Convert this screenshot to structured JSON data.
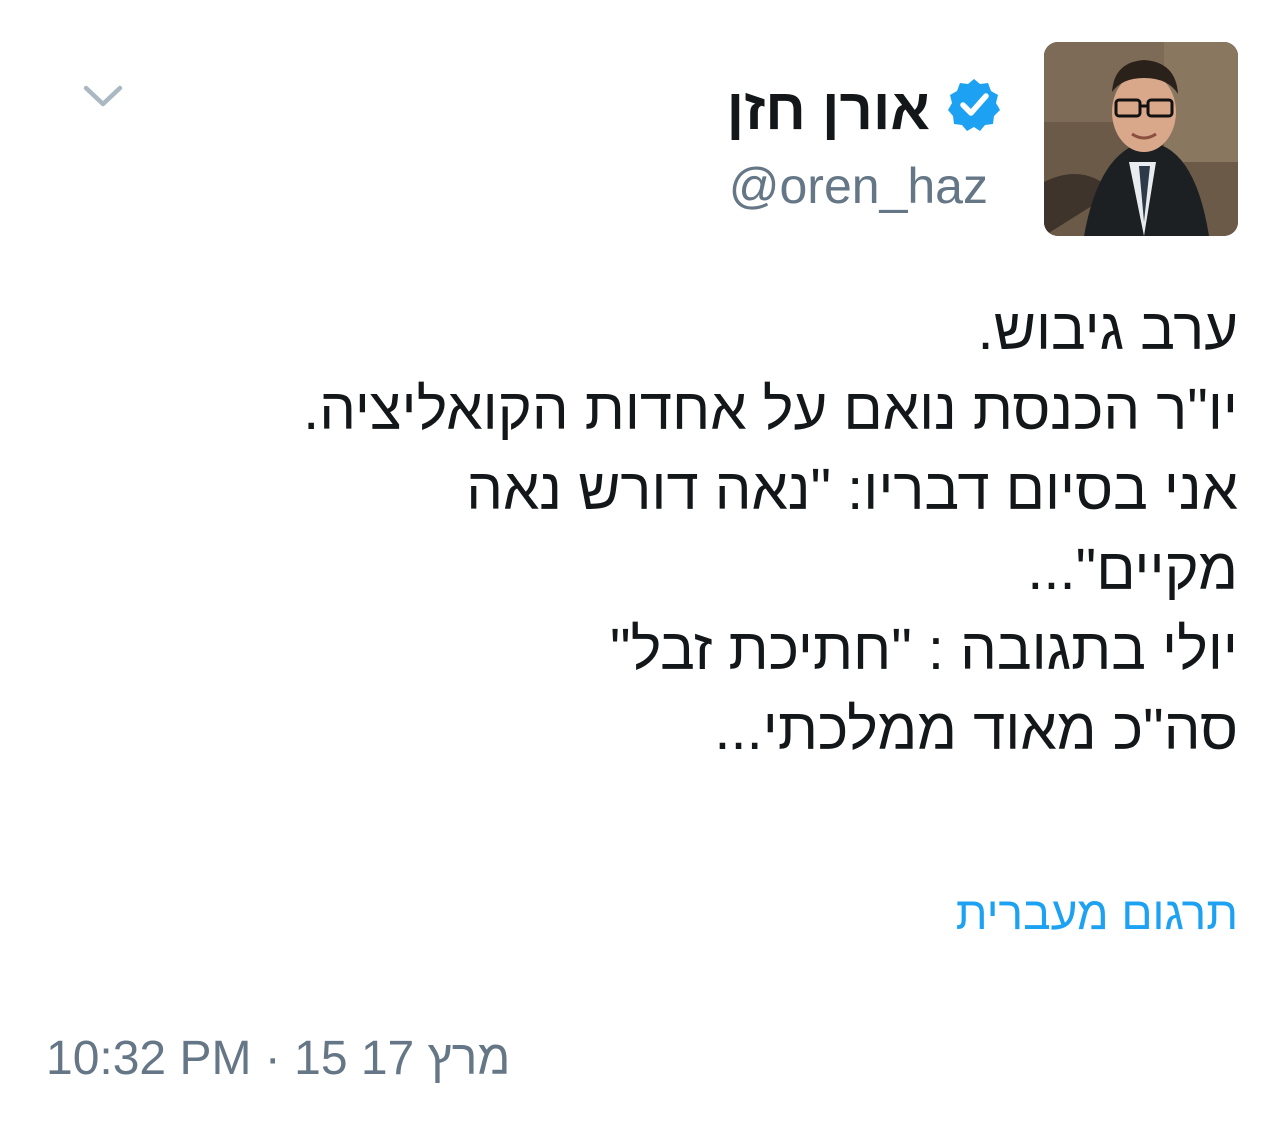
{
  "tweet": {
    "author": {
      "display_name": "אורן חזן",
      "handle": "@oren_haz",
      "verified": true,
      "verified_icon": "verified-badge-icon"
    },
    "menu_icon": "chevron-down-icon",
    "text_lines": [
      "ערב גיבוש.",
      "יו\"ר הכנסת נואם על אחדות הקואליציה.",
      "אני בסיום דבריו: \"נאה דורש נאה",
      "מקיים\"...",
      "יולי בתגובה : \"חתיכת זבל\"",
      "סה\"כ מאוד ממלכתי..."
    ],
    "translate_label": "תרגום מעברית",
    "time": "10:32 PM",
    "separator": "·",
    "date": "מרץ 17 15"
  },
  "colors": {
    "link": "#1da1f2",
    "muted": "#657786",
    "text": "#14171a",
    "verified": "#1da1f2"
  }
}
